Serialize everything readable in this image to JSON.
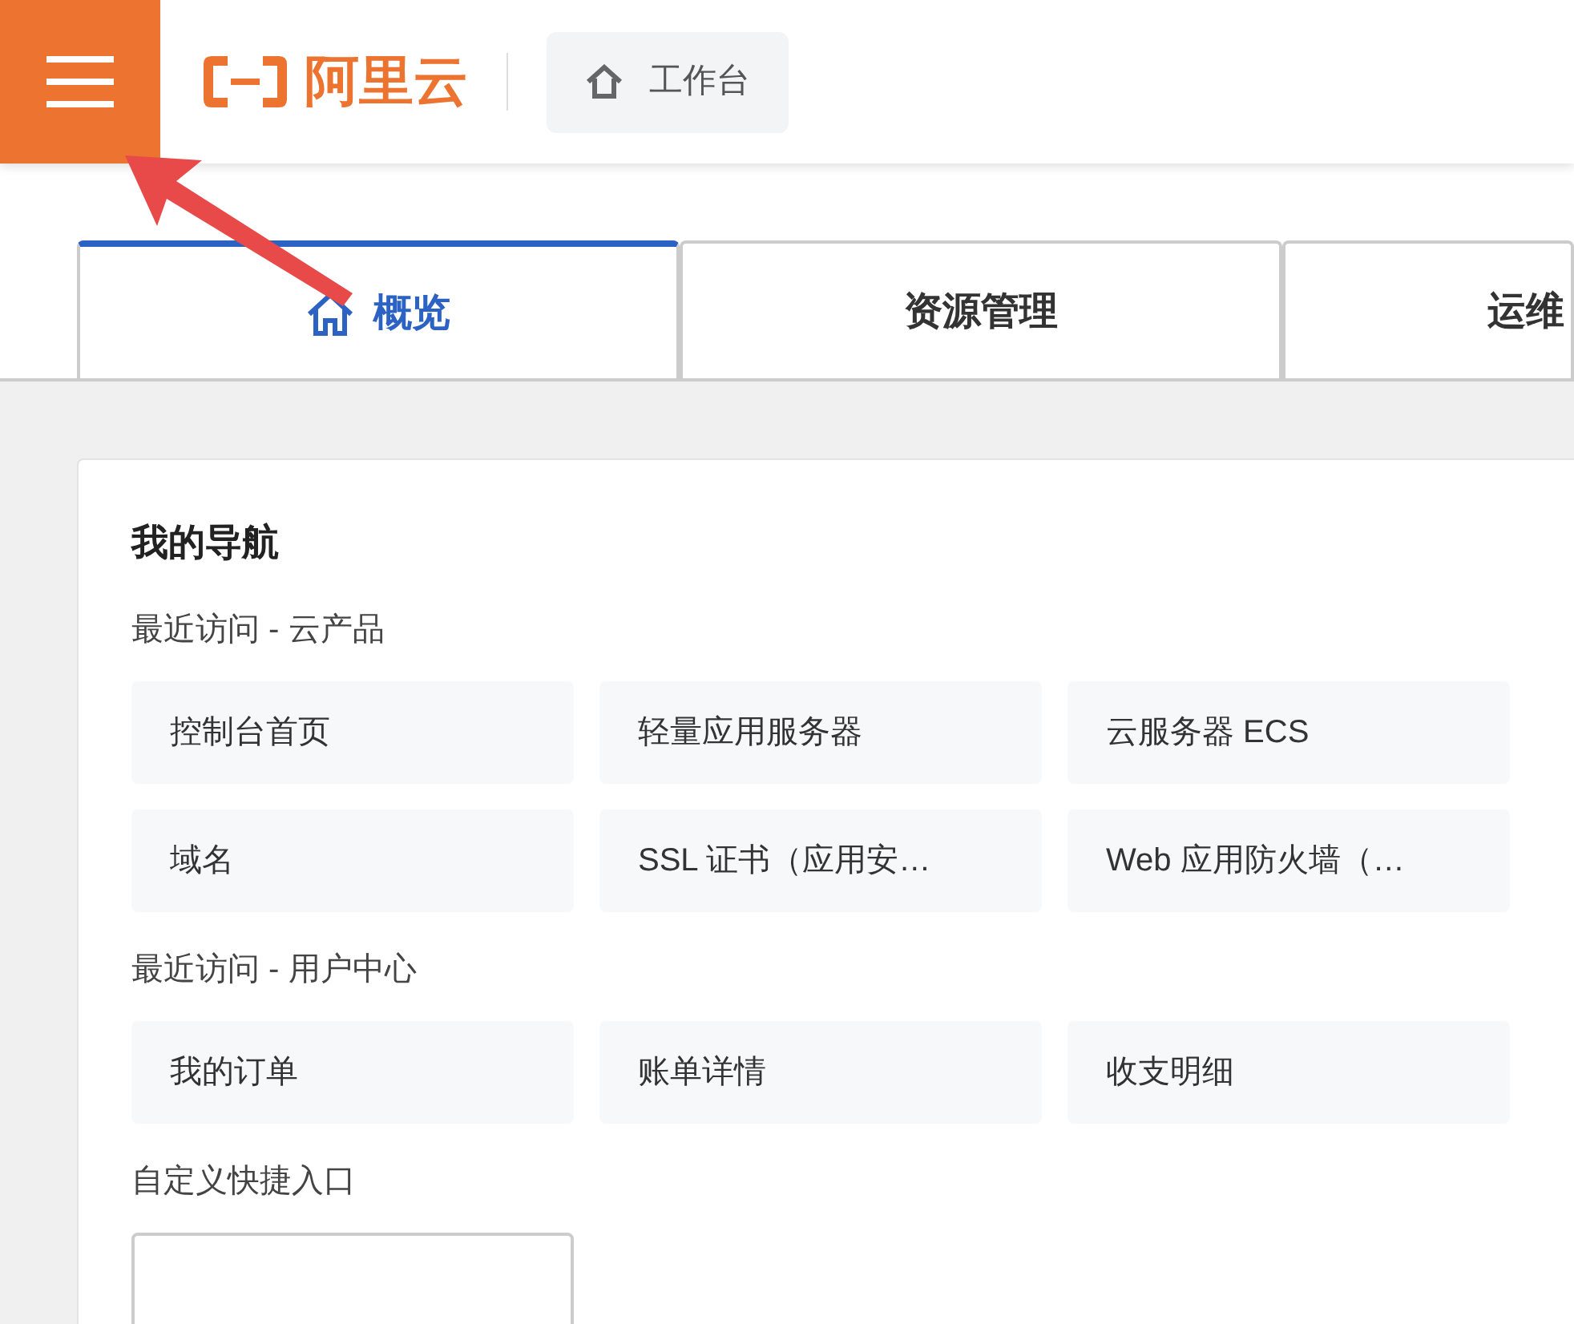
{
  "header": {
    "logo_text": "阿里云",
    "workbench_button": "工作台"
  },
  "tabs": [
    {
      "label": "概览",
      "selected": true
    },
    {
      "label": "资源管理",
      "selected": false
    },
    {
      "label": "运维",
      "selected": false
    }
  ],
  "navigation": {
    "title": "我的导航",
    "sections": [
      {
        "title": "最近访问 - 云产品",
        "items": [
          "控制台首页",
          "轻量应用服务器",
          "云服务器 ECS",
          "域名",
          "SSL 证书（应用安…",
          "Web 应用防火墙（…"
        ]
      },
      {
        "title": "最近访问 - 用户中心",
        "items": [
          "我的订单",
          "账单详情",
          "收支明细"
        ]
      },
      {
        "title": "自定义快捷入口"
      }
    ]
  }
}
